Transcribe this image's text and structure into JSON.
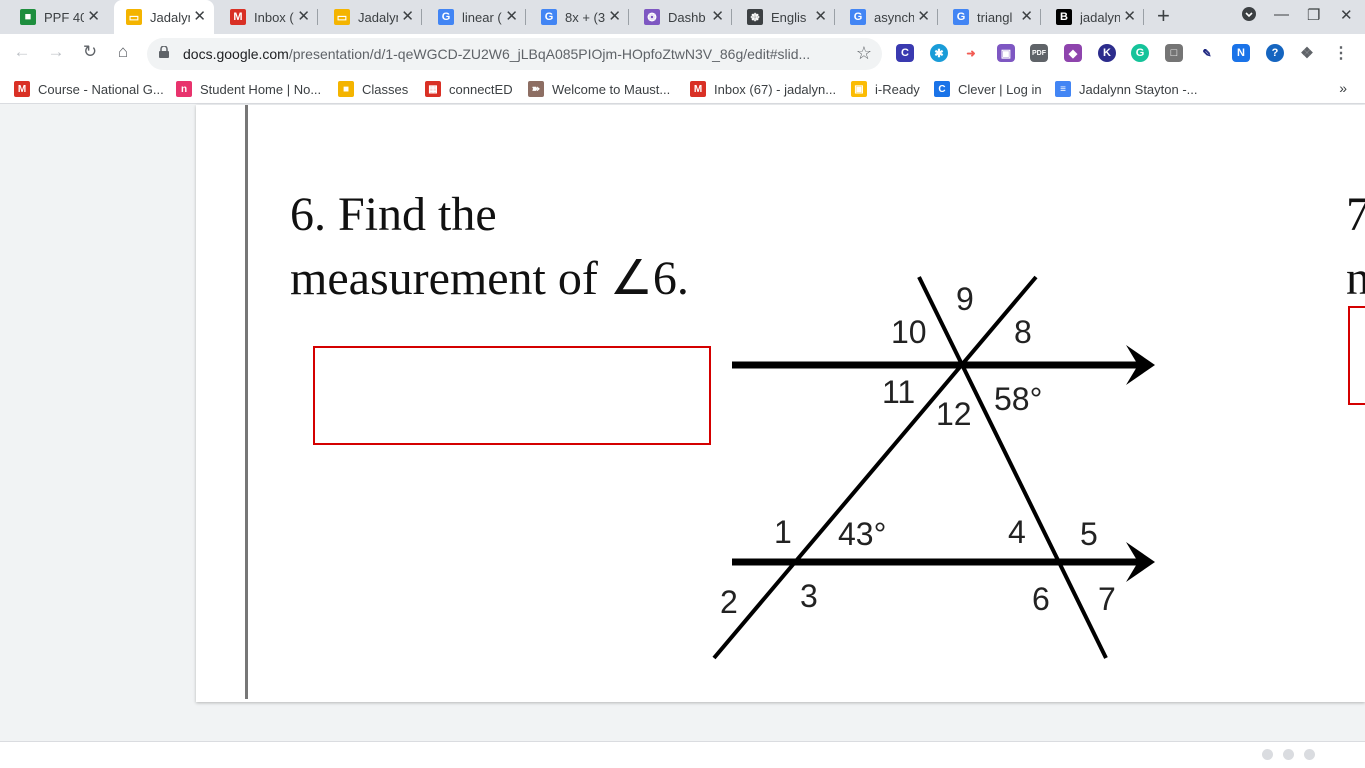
{
  "tabs": [
    {
      "title": "PPF 40",
      "icon": "classroom-icon",
      "color": "#1e8e3e",
      "glyph": "■"
    },
    {
      "title": "Jadalyn",
      "icon": "slides-icon",
      "color": "#f4b400",
      "glyph": "▭",
      "active": true
    },
    {
      "title": "Inbox (",
      "icon": "gmail-icon",
      "color": "#d93025",
      "glyph": "M"
    },
    {
      "title": "Jadalyn",
      "icon": "slides-icon",
      "color": "#f4b400",
      "glyph": "▭"
    },
    {
      "title": "linear (",
      "icon": "google-icon",
      "color": "#4285f4",
      "glyph": "G"
    },
    {
      "title": "8x + (3",
      "icon": "google-icon",
      "color": "#4285f4",
      "glyph": "G"
    },
    {
      "title": "Dashb",
      "icon": "lightbulb-icon",
      "color": "#7e57c2",
      "glyph": "❂"
    },
    {
      "title": "Englis",
      "icon": "bike-icon",
      "color": "#3c4043",
      "glyph": "☸"
    },
    {
      "title": "asynch",
      "icon": "google-icon",
      "color": "#4285f4",
      "glyph": "G"
    },
    {
      "title": "triangl",
      "icon": "google-icon",
      "color": "#4285f4",
      "glyph": "G"
    },
    {
      "title": "jadalyn",
      "icon": "brainly-icon",
      "color": "#000000",
      "glyph": "B"
    }
  ],
  "toolbar": {
    "url_host": "docs.google.com",
    "url_path": "/presentation/d/1-qeWGCD-ZU2W6_jLBqA085PIOjm-HOpfoZtwN3V_86g/edit#slid..."
  },
  "bookmarks": [
    {
      "label": "Course - National G...",
      "icon": "national-geographic-icon",
      "color": "#d93025",
      "glyph": "M"
    },
    {
      "label": "Student Home | No...",
      "icon": "noredink-icon",
      "color": "#e8336d",
      "glyph": "n"
    },
    {
      "label": "Classes",
      "icon": "classroom-icon",
      "color": "#f4b400",
      "glyph": "■"
    },
    {
      "label": "connectED",
      "icon": "mcgraw-hill-icon",
      "color": "#d93025",
      "glyph": "▦"
    },
    {
      "label": "Welcome to Maust...",
      "icon": "school-icon",
      "color": "#8d6e63",
      "glyph": "➽"
    },
    {
      "label": "Inbox (67) - jadalyn...",
      "icon": "gmail-icon",
      "color": "#d93025",
      "glyph": "M"
    },
    {
      "label": "i-Ready",
      "icon": "iready-icon",
      "color": "#fbbc04",
      "glyph": "▣"
    },
    {
      "label": "Clever | Log in",
      "icon": "clever-icon",
      "color": "#1a73e8",
      "glyph": "C"
    },
    {
      "label": "Jadalynn Stayton -...",
      "icon": "docs-icon",
      "color": "#4285f4",
      "glyph": "≡"
    }
  ],
  "bookmarks_more": "»",
  "slide": {
    "question_line1": "6. Find the",
    "question_line2": "measurement of ∠6.",
    "next_question_line1": "7",
    "next_question_line2": "n",
    "border_color": "#d40000"
  },
  "diagram": {
    "labels": [
      {
        "id": "angle-9",
        "text": "9"
      },
      {
        "id": "angle-10",
        "text": "10"
      },
      {
        "id": "angle-8",
        "text": "8"
      },
      {
        "id": "angle-11",
        "text": "11"
      },
      {
        "id": "angle-12",
        "text": "12"
      },
      {
        "id": "angle-58",
        "text": "58°"
      },
      {
        "id": "angle-1",
        "text": "1"
      },
      {
        "id": "angle-43",
        "text": "43°"
      },
      {
        "id": "angle-4",
        "text": "4"
      },
      {
        "id": "angle-5",
        "text": "5"
      },
      {
        "id": "angle-2",
        "text": "2"
      },
      {
        "id": "angle-3",
        "text": "3"
      },
      {
        "id": "angle-6",
        "text": "6"
      },
      {
        "id": "angle-7",
        "text": "7"
      }
    ]
  }
}
